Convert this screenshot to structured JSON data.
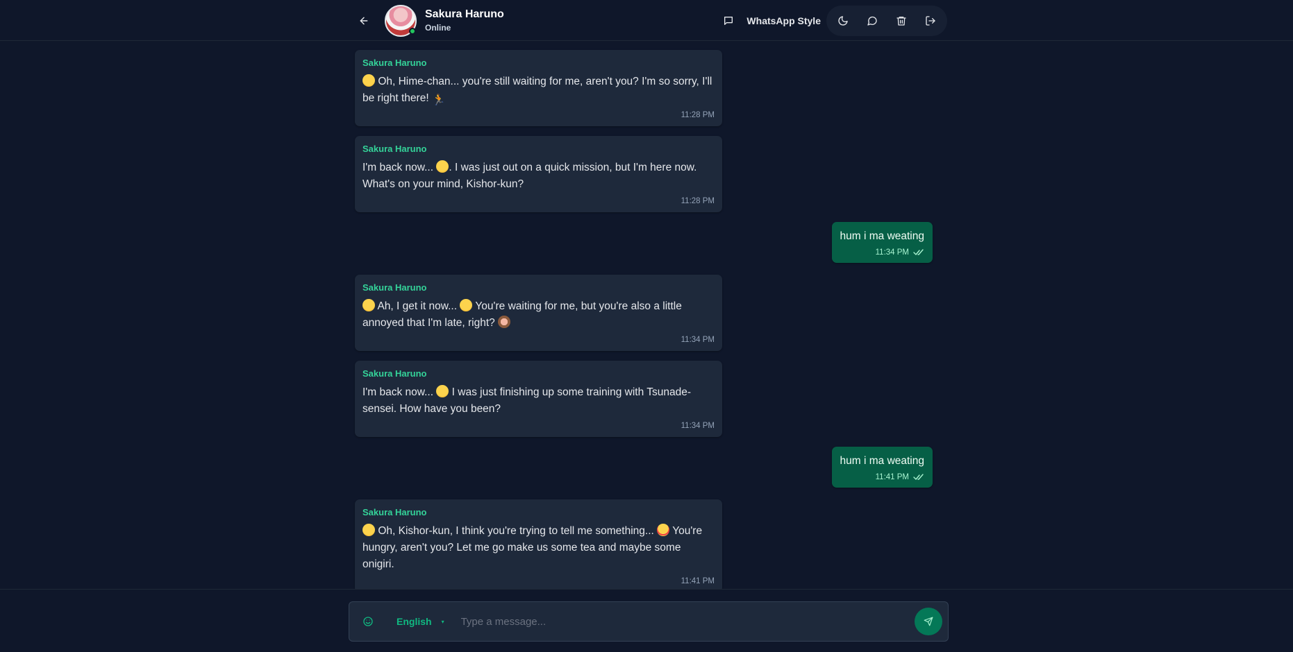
{
  "header": {
    "contact_name": "Sakura Haruno",
    "status": "Online",
    "style_label": "WhatsApp Style",
    "icons": [
      "back-arrow-icon",
      "chat-square-icon",
      "moon-icon",
      "chat-bubble-icon",
      "trash-icon",
      "logout-icon"
    ]
  },
  "messages": [
    {
      "direction": "in",
      "sender": "Sakura Haruno",
      "text": "Oh, Hime-chan... you're still waiting for me, aren't you? I'm so sorry, I'll be right there!",
      "time": "11:28 PM"
    },
    {
      "direction": "in",
      "sender": "Sakura Haruno",
      "text_a": "I'm back now...",
      "text_b": ". I was just out on a quick mission, but I'm here now. What's on your mind, Kishor-kun?",
      "time": "11:28 PM"
    },
    {
      "direction": "out",
      "text": "hum i ma weating",
      "time": "11:34 PM"
    },
    {
      "direction": "in",
      "sender": "Sakura Haruno",
      "text_a": "Ah, I get it now...",
      "text_b": "You're waiting for me, but you're also a little annoyed that I'm late, right?",
      "time": "11:34 PM"
    },
    {
      "direction": "in",
      "sender": "Sakura Haruno",
      "text_a": "I'm back now...",
      "text_b": "I was just finishing up some training with Tsunade-sensei. How have you been?",
      "time": "11:34 PM"
    },
    {
      "direction": "out",
      "text": "hum i ma weating",
      "time": "11:41 PM"
    },
    {
      "direction": "in",
      "sender": "Sakura Haruno",
      "text_a": "Oh, Kishor-kun, I think you're trying to tell me something...",
      "text_b": "You're hungry, aren't you? Let me go make us some tea and maybe some onigiri.",
      "time": "11:41 PM"
    }
  ],
  "composer": {
    "language": "English",
    "placeholder": "Type a message..."
  },
  "colors": {
    "background": "#0f172a",
    "incoming_bubble": "#1e293b",
    "outgoing_bubble": "#065f46",
    "accent": "#10b981"
  }
}
